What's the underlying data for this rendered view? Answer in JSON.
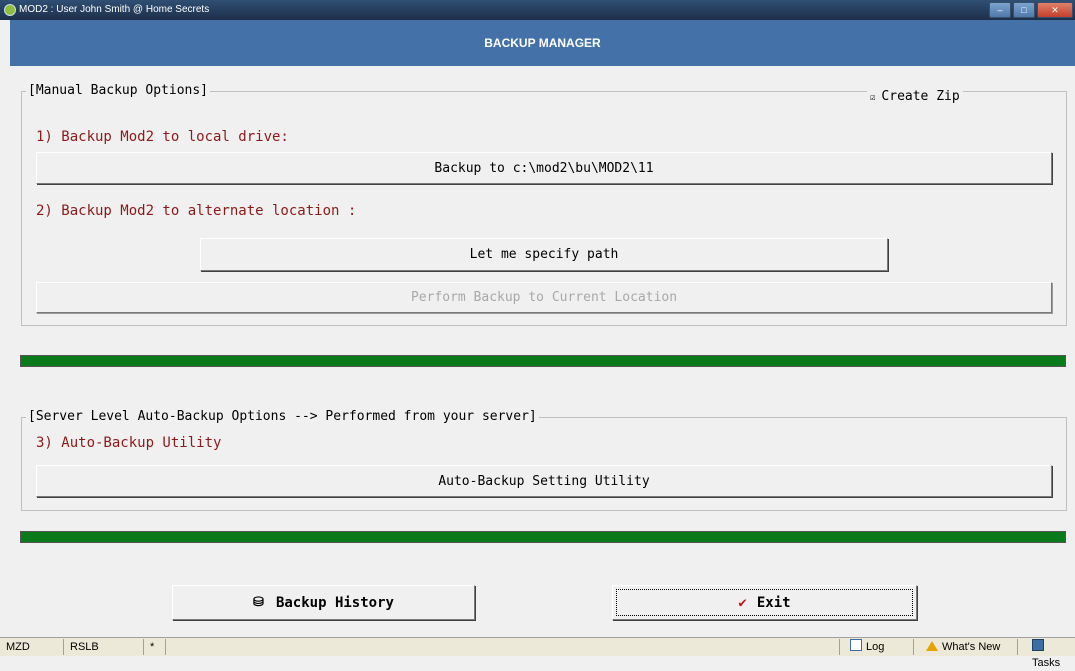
{
  "window": {
    "title": "MOD2 : User John Smith @ Home Secrets",
    "controls": [
      "minimize-icon",
      "maximize-icon",
      "close-icon"
    ]
  },
  "header": {
    "title": "BACKUP MANAGER"
  },
  "manual_group": {
    "title": "[Manual Backup Options]",
    "create_zip": {
      "label": "Create Zip",
      "checked": true
    },
    "step1_label": "1) Backup Mod2 to local drive:",
    "backup_local_button": "Backup to c:\\mod2\\bu\\MOD2\\11",
    "step2_label": "2) Backup Mod2 to alternate location :",
    "specify_path_button": "Let me specify path",
    "perform_backup_button": "Perform Backup to Current Location"
  },
  "progress1": {
    "value": 1.0,
    "color": "#0b7a1b"
  },
  "server_group": {
    "title": "[Server Level Auto-Backup Options --> Performed from your server]",
    "step3_label": "3) Auto-Backup Utility",
    "auto_backup_button": "Auto-Backup Setting Utility"
  },
  "progress2": {
    "value": 1.0,
    "color": "#0b7a1b"
  },
  "footer": {
    "backup_history_button": "Backup History",
    "exit_button": "Exit"
  },
  "statusbar": {
    "cells": [
      "MZD",
      "RSLB",
      "*"
    ],
    "log": "Log",
    "whats_new": "What's New",
    "tasks": "Tasks"
  },
  "colors": {
    "header": "#4472a8",
    "label_red": "#8b1a1a",
    "progress": "#0b7a1b"
  }
}
